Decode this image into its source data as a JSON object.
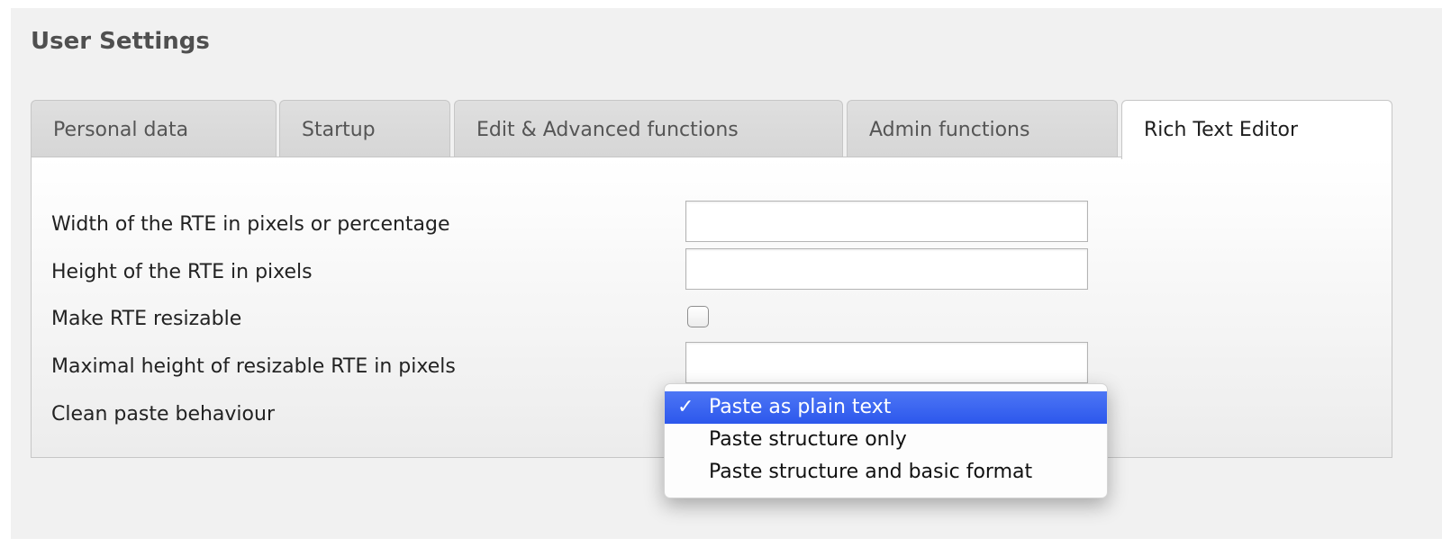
{
  "page": {
    "title": "User Settings"
  },
  "tabs": [
    {
      "label": "Personal data",
      "active": false
    },
    {
      "label": "Startup",
      "active": false
    },
    {
      "label": "Edit & Advanced functions",
      "active": false
    },
    {
      "label": "Admin functions",
      "active": false
    },
    {
      "label": "Rich Text Editor",
      "active": true
    }
  ],
  "form": {
    "rte_width": {
      "label": "Width of the RTE in pixels or percentage",
      "value": ""
    },
    "rte_height": {
      "label": "Height of the RTE in pixels",
      "value": ""
    },
    "rte_resizable": {
      "label": "Make RTE resizable",
      "checked": false
    },
    "rte_max_height": {
      "label": "Maximal height of resizable RTE in pixels",
      "value": ""
    },
    "clean_paste": {
      "label": "Clean paste behaviour",
      "selected": "Paste as plain text",
      "options": [
        {
          "label": "Paste as plain text",
          "selected": true
        },
        {
          "label": "Paste structure only",
          "selected": false
        },
        {
          "label": "Paste structure and basic format",
          "selected": false
        }
      ]
    }
  },
  "icons": {
    "checkmark": "✓"
  },
  "colors": {
    "selection": "#2f5cf0",
    "panel_background": "#f1f1f1",
    "title": "#4f4f4f"
  }
}
